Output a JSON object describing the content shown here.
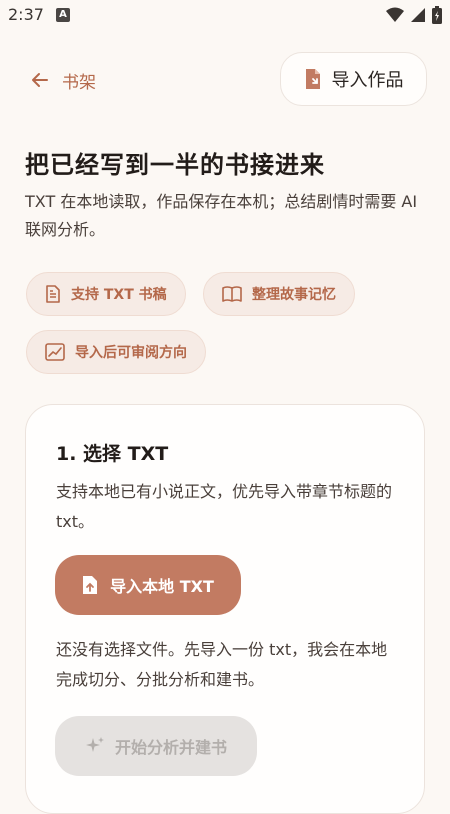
{
  "status_bar": {
    "time": "2:37",
    "app_icon_letter": "A"
  },
  "header": {
    "back_label": "书架",
    "import_label": "导入作品"
  },
  "intro": {
    "title": "把已经写到一半的书接进来",
    "description": "TXT 在本地读取，作品保存在本机；总结剧情时需要 AI 联网分析。"
  },
  "chips": [
    {
      "label": "支持 TXT 书稿",
      "icon": "document-icon"
    },
    {
      "label": "整理故事记忆",
      "icon": "book-icon"
    },
    {
      "label": "导入后可审阅方向",
      "icon": "review-icon"
    }
  ],
  "step_card": {
    "title": "1. 选择 TXT",
    "description": "支持本地已有小说正文，优先导入带章节标题的 txt。",
    "import_button_label": "导入本地 TXT",
    "file_status": "还没有选择文件。先导入一份 txt，我会在本地完成切分、分批分析和建书。",
    "start_button_label": "开始分析并建书"
  },
  "colors": {
    "accent": "#c27b62",
    "accent_text": "#b4684a",
    "background": "#fcf8f4",
    "chip_bg": "#f6ebe5",
    "disabled_bg": "#e5e2e0"
  }
}
